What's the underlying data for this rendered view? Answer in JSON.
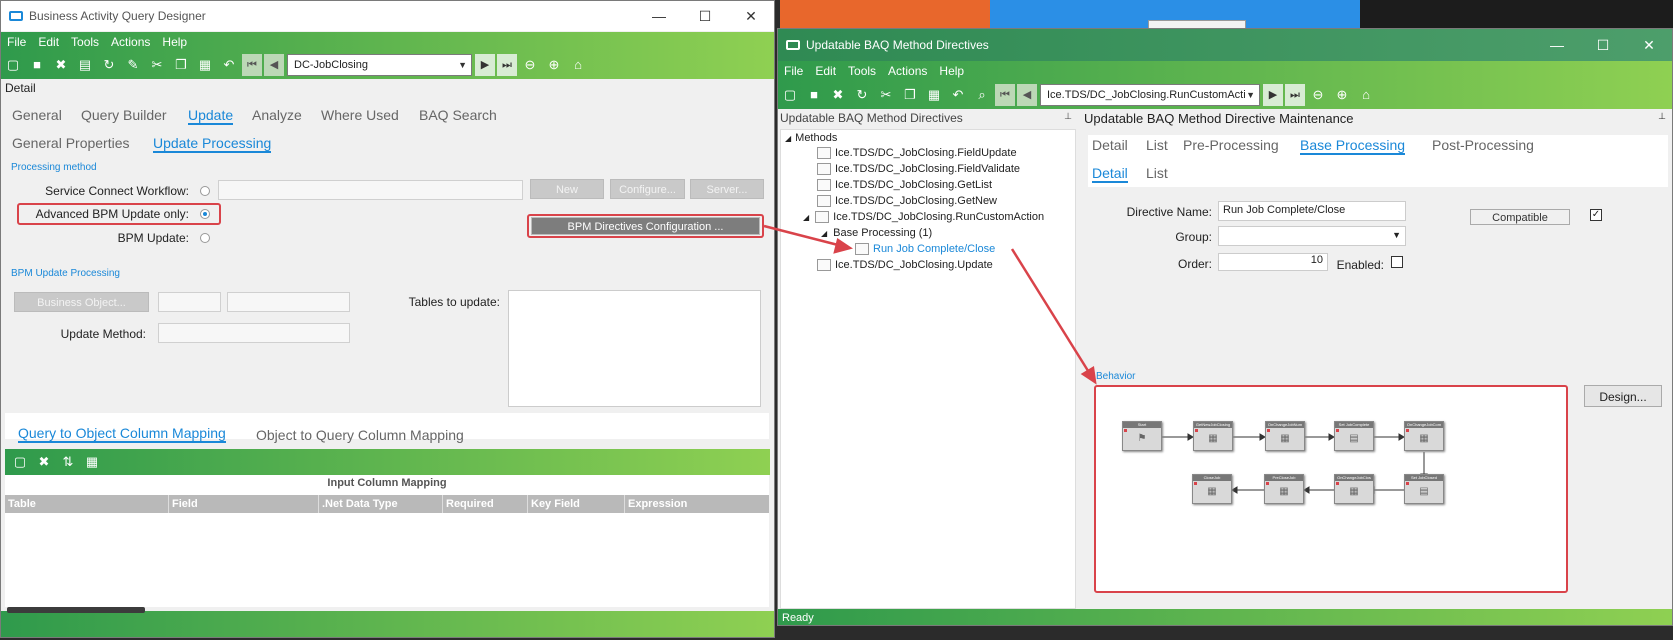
{
  "left": {
    "title": "Business Activity Query Designer",
    "menu": [
      "File",
      "Edit",
      "Tools",
      "Actions",
      "Help"
    ],
    "nav_combo": "DC-JobClosing",
    "detail": "Detail",
    "tabs": [
      "General",
      "Query Builder",
      "Update",
      "Analyze",
      "Where Used",
      "BAQ Search"
    ],
    "subtabs": [
      "General Properties",
      "Update  Processing"
    ],
    "processing_method": "Processing method",
    "service_connect": "Service Connect Workflow:",
    "advanced_bpm": "Advanced BPM Update only:",
    "bpm_update": "BPM Update:",
    "btn_new": "New",
    "btn_configure": "Configure...",
    "btn_server": "Server...",
    "btn_bpm_config": "BPM Directives Configuration ...",
    "bpm_update_processing": "BPM Update Processing",
    "btn_business_object": "Business Object...",
    "tables_to_update": "Tables to update:",
    "update_method": "Update Method:",
    "mapping_tabs": [
      "Query to Object Column Mapping",
      "Object to Query Column Mapping"
    ],
    "grid_title": "Input Column Mapping",
    "grid_cols": [
      "Table",
      "Field",
      ".Net Data Type",
      "Required",
      "Key Field",
      "Expression"
    ]
  },
  "right": {
    "title": "Updatable BAQ Method Directives",
    "menu": [
      "File",
      "Edit",
      "Tools",
      "Actions",
      "Help"
    ],
    "nav_combo": "Ice.TDS/DC_JobClosing.RunCustomActi",
    "tree_header": "Updatable BAQ Method Directives",
    "tree_root": "Methods",
    "tree_items": [
      "Ice.TDS/DC_JobClosing.FieldUpdate",
      "Ice.TDS/DC_JobClosing.FieldValidate",
      "Ice.TDS/DC_JobClosing.GetList",
      "Ice.TDS/DC_JobClosing.GetNew",
      "Ice.TDS/DC_JobClosing.RunCustomAction"
    ],
    "tree_sub": "Base Processing (1)",
    "tree_leaf": "Run Job Complete/Close",
    "tree_last": "Ice.TDS/DC_JobClosing.Update",
    "panel_header": "Updatable BAQ Method Directive Maintenance",
    "tabs": [
      "Detail",
      "List",
      "Pre-Processing",
      "Base Processing",
      "Post-Processing"
    ],
    "subtabs": [
      "Detail",
      "List"
    ],
    "directive_name_label": "Directive Name:",
    "directive_name": "Run Job Complete/Close",
    "group_label": "Group:",
    "order_label": "Order:",
    "order": "10",
    "enabled_label": "Enabled:",
    "compatible": "Compatible",
    "behavior": "Behavior",
    "design": "Design...",
    "status": "Ready",
    "flow_nodes": [
      "Start",
      "GetNewJobClosing",
      "OnChangeJobNum",
      "Set JobComplete",
      "OnChangeJobCom",
      "Set JobClosed",
      "OnChangeJobClos",
      "PreCloseJob",
      "CloseJob"
    ]
  },
  "colors": {
    "accent": "#1a88d8",
    "green_dark": "#2f9a4c",
    "green_light": "#8fd052",
    "highlight": "#d9434a"
  }
}
